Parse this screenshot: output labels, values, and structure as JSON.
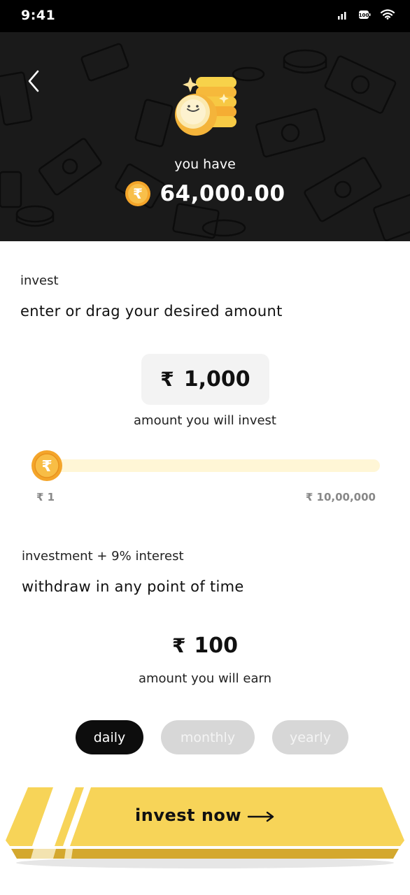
{
  "status_bar": {
    "time": "9:41"
  },
  "header": {
    "you_have_label": "you have",
    "balance": "64,000.00"
  },
  "invest_section": {
    "title": "invest",
    "subtitle": "enter or drag your desired amount",
    "currency_symbol": "₹",
    "amount": "1,000",
    "caption": "amount you will invest"
  },
  "slider": {
    "min_label": "₹ 1",
    "max_label": "₹ 10,00,000",
    "value_fraction": 0.001
  },
  "earnings_section": {
    "title": "investment + 9% interest",
    "subtitle": "withdraw in any point of time",
    "currency_symbol": "₹",
    "earn_amount": "100",
    "caption": "amount you will earn"
  },
  "period_tabs": [
    {
      "label": "daily",
      "selected": true
    },
    {
      "label": "monthly",
      "selected": false
    },
    {
      "label": "yearly",
      "selected": false
    }
  ],
  "cta": {
    "label": "invest now"
  },
  "colors": {
    "accent_yellow": "#f7d458",
    "coin_orange": "#f4a52a",
    "dark_bg": "#1a1a1a",
    "selected_tab": "#0d0d0d",
    "unselected_tab": "#d7d7d7"
  }
}
